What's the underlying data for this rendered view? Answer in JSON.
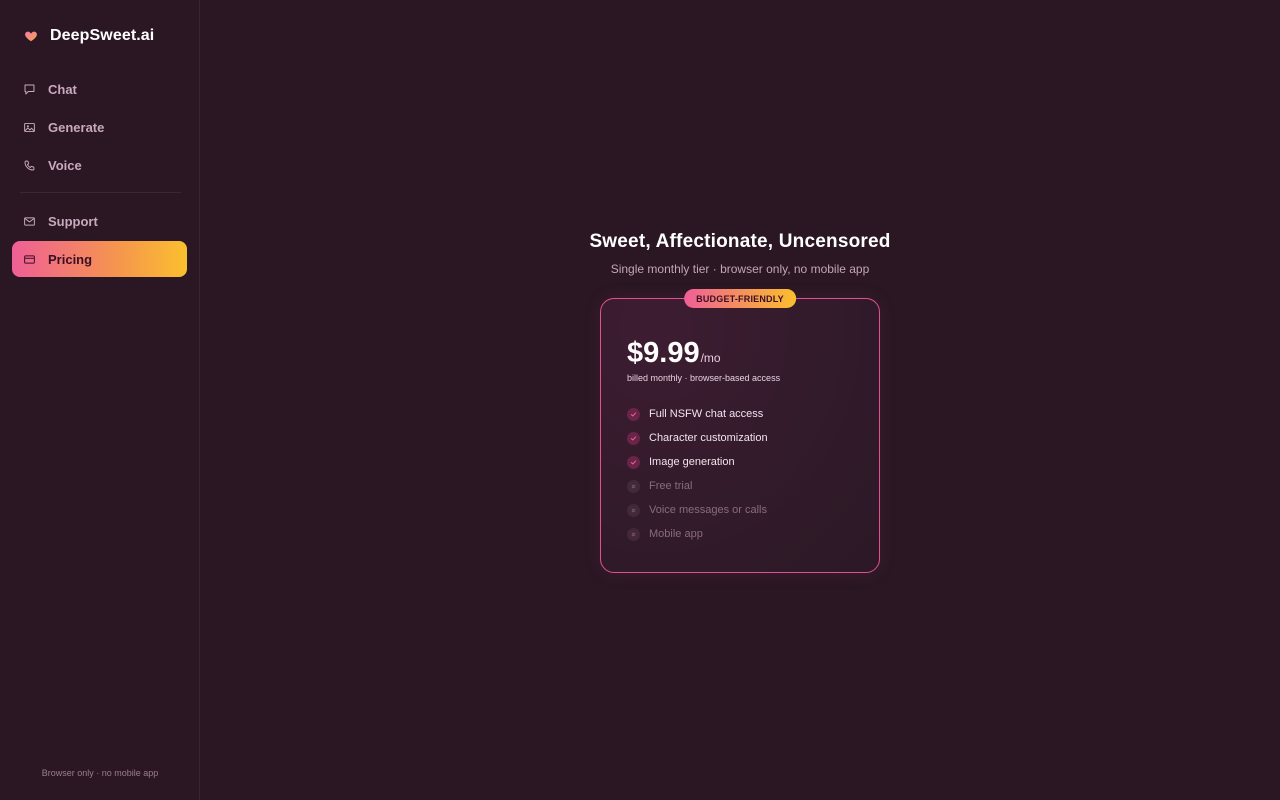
{
  "app": {
    "brand_name": "DeepSweet.ai",
    "brand_icon": "heart-icon",
    "accent_gradient": [
      "#ef5f97",
      "#f5954e",
      "#fbbf2e"
    ]
  },
  "sidebar": {
    "items": [
      {
        "label": "Chat",
        "icon": "chat-bubble-icon"
      },
      {
        "label": "Generate",
        "icon": "image-icon"
      },
      {
        "label": "Voice",
        "icon": "phone-icon"
      }
    ],
    "secondary_items": [
      {
        "label": "Support",
        "icon": "mail-icon"
      },
      {
        "label": "Pricing",
        "icon": "credit-card-icon",
        "active": true
      }
    ],
    "footer": "Browser only · no mobile app"
  },
  "main": {
    "headline": "Sweet, Affectionate, Uncensored",
    "subline": "Single monthly tier · browser only, no mobile app",
    "plan": {
      "badge": "BUDGET-FRIENDLY",
      "price": "$9.99",
      "period": "/mo",
      "billing": "billed monthly · browser-based access",
      "features": [
        {
          "label": "Full NSFW chat access",
          "included": true
        },
        {
          "label": "Character customization",
          "included": true
        },
        {
          "label": "Image generation",
          "included": true
        },
        {
          "label": "Free trial",
          "included": false
        },
        {
          "label": "Voice messages or calls",
          "included": false
        },
        {
          "label": "Mobile app",
          "included": false
        }
      ]
    }
  }
}
